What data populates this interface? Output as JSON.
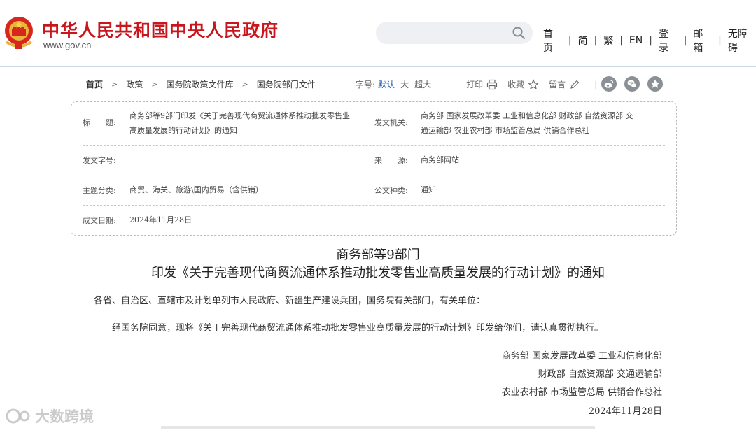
{
  "header": {
    "site_title": "中华人民共和国中央人民政府",
    "site_url": "www.gov.cn",
    "search_placeholder": "",
    "nav": [
      "首页",
      "简",
      "繁",
      "EN",
      "登录",
      "邮箱",
      "无障碍"
    ],
    "nav_sep": "|"
  },
  "breadcrumb": [
    "首页",
    "政策",
    "国务院政策文件库",
    "国务院部门文件"
  ],
  "tools": {
    "font_label": "字号:",
    "font_default": "默认",
    "font_large": "大",
    "font_xlarge": "超大",
    "print": "打印",
    "favorite": "收藏",
    "comment": "留言",
    "pipe": "|"
  },
  "share_icons": [
    "weibo-icon",
    "wechat-icon",
    "favorite-star-icon"
  ],
  "info": {
    "title_label": "标　　题:",
    "title_value_line1": "商务部等9部门印发《关于完善现代商贸流通体系推动批发零售业",
    "title_value_line2": "高质量发展的行动计划》的通知",
    "issuer_label": "发文机关:",
    "issuer_value_line1": "商务部  国家发展改革委  工业和信息化部  财政部  自然资源部  交",
    "issuer_value_line2": "通运输部  农业农村部  市场监管总局  供销合作总社",
    "doc_no_label": "发文字号:",
    "doc_no_value": "",
    "source_label": "来　　源:",
    "source_value": "商务部网站",
    "topic_label": "主题分类:",
    "topic_value": "商贸、海关、旅游\\国内贸易（含供销）",
    "type_label": "公文种类:",
    "type_value": "通知",
    "date_label": "成文日期:",
    "date_value": "2024年11月28日"
  },
  "article": {
    "title_line1": "商务部等9部门",
    "title_line2": "印发《关于完善现代商贸流通体系推动批发零售业高质量发展的行动计划》的通知",
    "addressee": "各省、自治区、直辖市及计划单列市人民政府、新疆生产建设兵团，国务院有关部门，有关单位：",
    "body": "经国务院同意，现将《关于完善现代商贸流通体系推动批发零售业高质量发展的行动计划》印发给你们，请认真贯彻执行。",
    "signers": [
      "商务部  国家发展改革委  工业和信息化部",
      "财政部  自然资源部  交通运输部",
      "农业农村部  市场监管总局  供销合作总社"
    ],
    "sign_date": "2024年11月28日"
  },
  "watermark": "大数跨境",
  "colors": {
    "brand_red": "#c8161d",
    "link_blue": "#1a5fb4",
    "share_gray": "#8b8f96"
  }
}
